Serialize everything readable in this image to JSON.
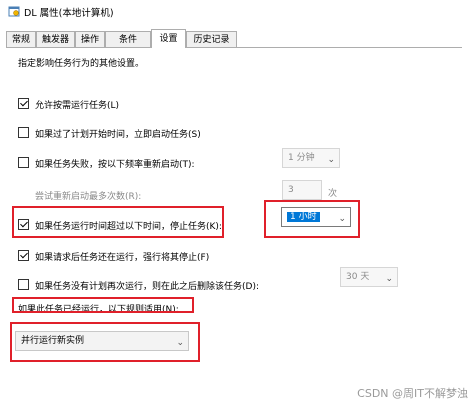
{
  "window": {
    "title": "DL 属性(本地计算机)"
  },
  "tabs": [
    "常规",
    "触发器",
    "操作",
    "条件",
    "设置",
    "历史记录"
  ],
  "active_tab": "设置",
  "description": "指定影响任务行为的其他设置。",
  "settings": {
    "allow_on_demand": {
      "label": "允许按需运行任务(L)",
      "checked": true
    },
    "run_asap_missed": {
      "label": "如果过了计划开始时间，立即启动任务(S)",
      "checked": false
    },
    "restart_on_fail": {
      "label": "如果任务失败，按以下频率重新启动(T):",
      "checked": false,
      "interval": "1 分钟"
    },
    "restart_attempts": {
      "label": "尝试重新启动最多次数(R):",
      "value": "3",
      "unit": "次"
    },
    "stop_if_runs_longer": {
      "label": "如果任务运行时间超过以下时间，停止任务(K):",
      "checked": true,
      "duration": "1 小时"
    },
    "force_stop": {
      "label": "如果请求后任务还在运行，强行将其停止(F)",
      "checked": true
    },
    "delete_if_not_scheduled": {
      "label": "如果任务没有计划再次运行，则在此之后删除该任务(D):",
      "checked": false,
      "after": "30 天"
    },
    "already_running_rule": {
      "label": "如果此任务已经运行，以下规则适用(N):",
      "value": "并行运行新实例"
    }
  },
  "watermark": "CSDN @周IT不解梦浊"
}
